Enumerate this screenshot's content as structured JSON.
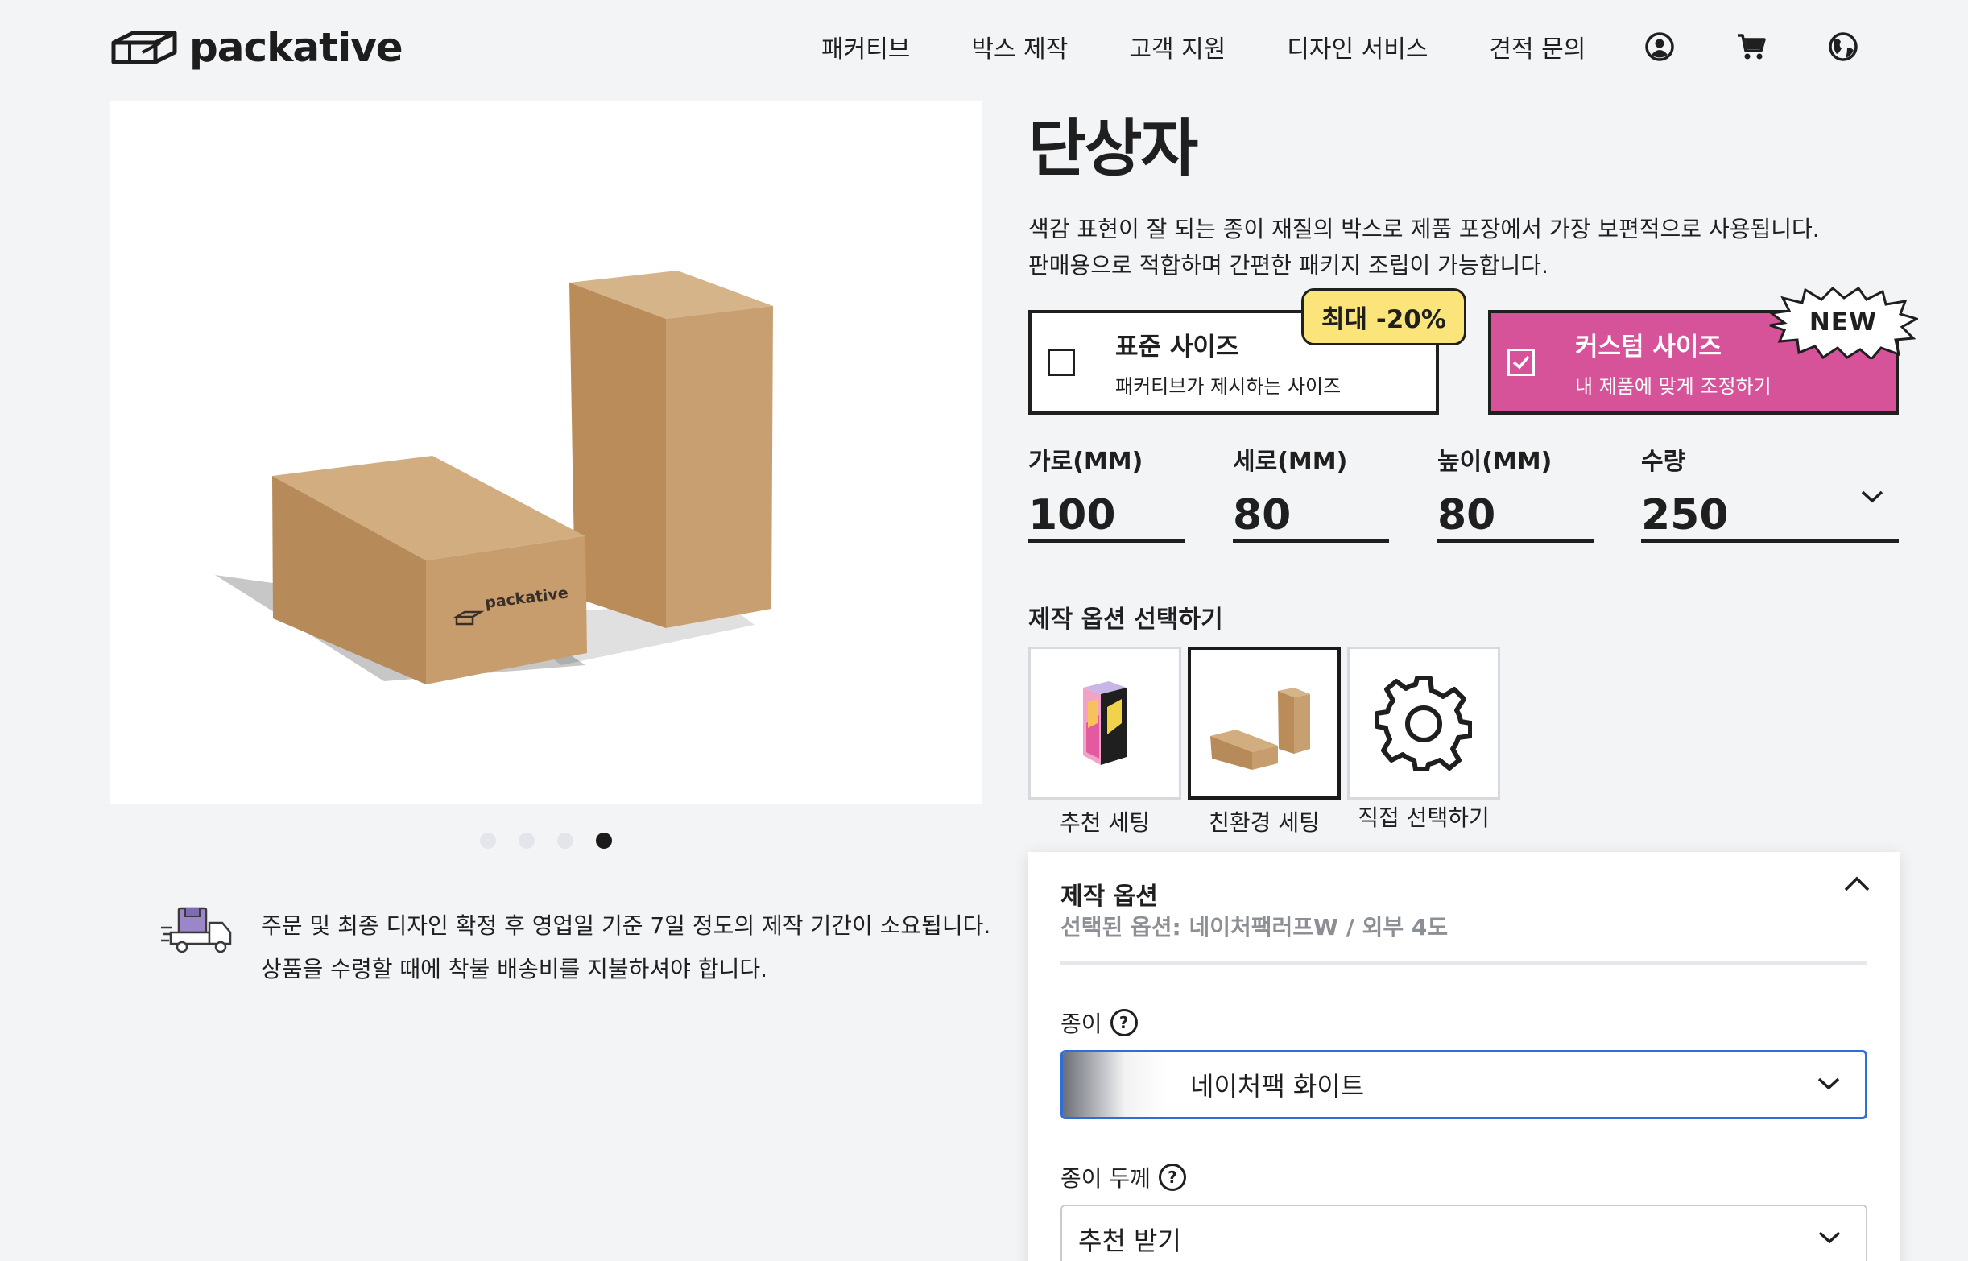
{
  "header": {
    "brand": "packative",
    "nav": [
      "패커티브",
      "박스 제작",
      "고객 지원",
      "디자인 서비스",
      "견적 문의"
    ],
    "icons": [
      "account-icon",
      "cart-icon",
      "globe-icon"
    ]
  },
  "product": {
    "box_logo_text": "packative",
    "carousel": {
      "total": 4,
      "active_index": 4
    },
    "shipping_notice": [
      "주문 및 최종 디자인 확정 후 영업일 기준 7일 정도의 제작 기간이 소요됩니다.",
      "상품을 수령할 때에 착불 배송비를 지불하셔야 합니다."
    ]
  },
  "main": {
    "title": "단상자",
    "description": [
      "색감 표현이 잘 되는 종이 재질의 박스로 제품 포장에서 가장 보편적으로 사용됩니다.",
      "판매용으로 적합하며 간편한 패키지 조립이 가능합니다."
    ],
    "size_options": {
      "standard": {
        "title": "표준 사이즈",
        "subtitle": "패커티브가 제시하는 사이즈",
        "badge": "최대 -20%",
        "checked": false
      },
      "custom": {
        "title": "커스텀 사이즈",
        "subtitle": "내 제품에 맞게 조정하기",
        "badge": "NEW",
        "checked": true
      }
    },
    "dimensions": {
      "width": {
        "label": "가로(MM)",
        "value": "100"
      },
      "depth": {
        "label": "세로(MM)",
        "value": "80"
      },
      "height": {
        "label": "높이(MM)",
        "value": "80"
      },
      "quantity": {
        "label": "수량",
        "value": "250"
      }
    },
    "production_presets": {
      "label": "제작 옵션 선택하기",
      "items": [
        {
          "label": "추천 세팅",
          "selected": false
        },
        {
          "label": "친환경 세팅",
          "selected": true
        },
        {
          "label": "직접 선택하기",
          "selected": false
        }
      ]
    },
    "options_panel": {
      "title": "제작 옵션",
      "selected_summary": "선택된 옵션: 네이처팩러프W / 외부 4도",
      "paper": {
        "label": "종이",
        "help": "?",
        "value": "네이처팩 화이트"
      },
      "thickness": {
        "label": "종이 두께",
        "help": "?",
        "value": "추천 받기"
      }
    }
  },
  "colors": {
    "background": "#f3f4f6",
    "accent_pink": "#d6539a",
    "badge_yellow": "#fbe57a",
    "select_focus": "#2f6ed8",
    "kraft": "#c9a06e"
  }
}
